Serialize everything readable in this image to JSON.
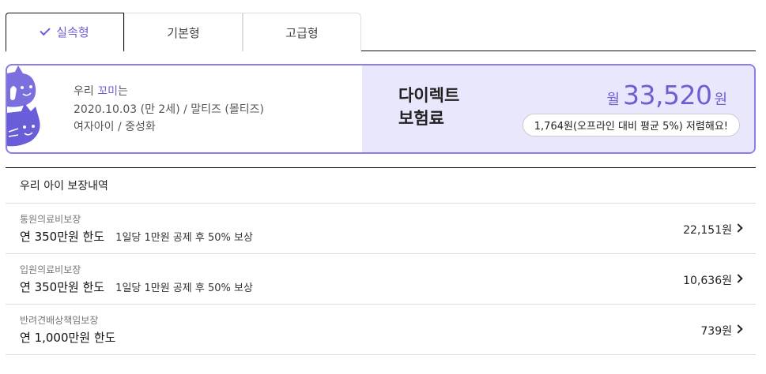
{
  "tabs": [
    {
      "label": "실속형",
      "selected": true
    },
    {
      "label": "기본형",
      "selected": false
    },
    {
      "label": "고급형",
      "selected": false
    }
  ],
  "pet": {
    "prefix": "우리 ",
    "name": "꼬미",
    "suffix": "는",
    "birth_breed": "2020.10.03 (만 2세) / 말티즈 (몰티즈)",
    "gender": "여자아이 / 중성화"
  },
  "premium": {
    "title_line1": "다이렉트",
    "title_line2": "보험료",
    "unit": "월",
    "amount": "33,520",
    "won": "원",
    "savings": "1,764원(오프라인 대비 평균 5%) 저렴해요!"
  },
  "coverage": {
    "header": "우리 아이 보장내역",
    "items": [
      {
        "category": "통원의료비보장",
        "limit": "연 350만원 한도",
        "detail": "1일당 1만원 공제 후 50% 보상",
        "amount": "22,151원"
      },
      {
        "category": "입원의료비보장",
        "limit": "연 350만원 한도",
        "detail": "1일당 1만원 공제 후 50% 보상",
        "amount": "10,636원"
      },
      {
        "category": "반려견배상책임보장",
        "limit": "연 1,000만원 한도",
        "detail": "",
        "amount": "739원"
      }
    ]
  },
  "colors": {
    "accent": "#6d5fd3",
    "card_border": "#8a7ee8",
    "card_bg": "#e9e7fb"
  },
  "icons": [
    "check-icon",
    "cat-dog-illustration",
    "chevron-right-icon"
  ]
}
